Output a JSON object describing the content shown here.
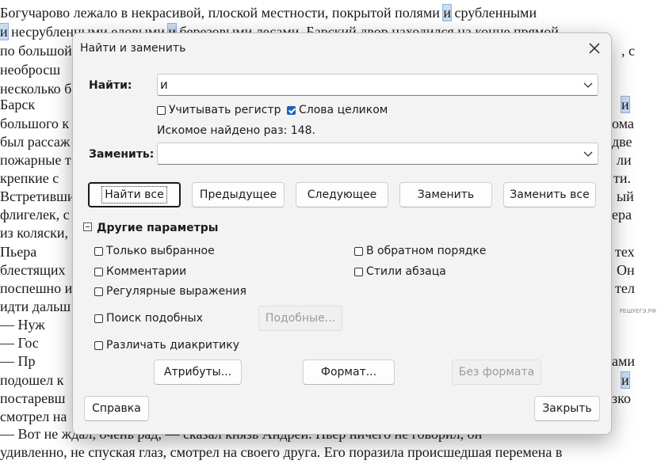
{
  "document": {
    "lines": [
      {
        "text": "        Богучарово лежало в некрасивой, плоской местности, покрытой полями ",
        "hl": "и",
        "tail": " срубленными"
      },
      {
        "text": "",
        "hl": "и",
        "tail": " несрубленными еловыми и березовыми лесами. Барский двор находился на конце прямой,"
      },
      {
        "text": "по большой",
        "hl": "",
        "tail": "                                                                                                   , с"
      },
      {
        "text": "необросш",
        "hl": "",
        "tail": ""
      },
      {
        "text": "несколько б",
        "hl": "",
        "tail": ""
      },
      {
        "text": "        Барск",
        "hl": "",
        "tail": ""
      },
      {
        "text": "большого к",
        "hl": "",
        "tail": ""
      },
      {
        "text": "был рассаж",
        "hl": "",
        "tail": ""
      },
      {
        "text": "пожарные т",
        "hl": "",
        "tail": ""
      },
      {
        "text": "крепкие  с",
        "hl": "",
        "tail": ""
      },
      {
        "text": "Встретивши",
        "hl": "",
        "tail": ""
      },
      {
        "text": "флигелек, с",
        "hl": "",
        "tail": ""
      },
      {
        "text": "из коляски,",
        "hl": "",
        "tail": ""
      },
      {
        "text": "        Пьера",
        "hl": "",
        "tail": ""
      },
      {
        "text": "блестящих",
        "hl": "",
        "tail": ""
      },
      {
        "text": "поспешно и",
        "hl": "",
        "tail": ""
      },
      {
        "text": "идти дальш",
        "hl": "",
        "tail": ""
      },
      {
        "text": "        — Нуж",
        "hl": "",
        "tail": ""
      },
      {
        "text": "        — Гос",
        "hl": "",
        "tail": ""
      },
      {
        "text": "        — Пр",
        "hl": "",
        "tail": ""
      },
      {
        "text": "подошел к",
        "hl": "",
        "tail": ""
      },
      {
        "text": "постаревш",
        "hl": "",
        "tail": ""
      },
      {
        "text": "смотрел на",
        "hl": "",
        "tail": ""
      },
      {
        "text": "        — Вот не ждал, очень рад, — сказал князь Андрей. Пьер ничего не говорил, он",
        "hl": "",
        "tail": ""
      },
      {
        "text": "удивленно, не спуская глаз, смотрел на своего друга. Его поразила происшедшая перемена в",
        "hl": "",
        "tail": ""
      }
    ],
    "right_fragments": [
      "тех",
      "Он",
      "тел",
      "ами",
      "и",
      "зко",
      "ома",
      "две",
      "ли",
      "ти.",
      "ый",
      "ера"
    ],
    "watermark": "РЕШУЕГЭ.РФ"
  },
  "dialog": {
    "title": "Найти и заменить",
    "find_label": "Найти:",
    "find_value": "и",
    "match_case_label": "Учитывать регистр",
    "match_case_checked": false,
    "whole_words_label": "Слова целиком",
    "whole_words_checked": true,
    "status": "Искомое найдено раз: 148.",
    "replace_label": "Заменить:",
    "replace_value": "",
    "buttons": {
      "find_all": "Найти все",
      "previous": "Предыдущее",
      "next": "Следующее",
      "replace": "Заменить",
      "replace_all": "Заменить все"
    },
    "other_options_label": "Другие параметры",
    "options": {
      "current_selection": "Только выбранное",
      "backwards": "В обратном порядке",
      "comments": "Комментарии",
      "paragraph_styles": "Стили абзаца",
      "regex": "Регулярные выражения",
      "similarity": "Поиск подобных",
      "similarity_button": "Подобные...",
      "diacritics": "Различать диакритику"
    },
    "attributes_button": "Атрибуты...",
    "format_button": "Формат...",
    "no_format_button": "Без формата",
    "help_button": "Справка",
    "close_button": "Закрыть"
  },
  "colors": {
    "accent": "#1f5fbf",
    "highlight": "#c9dcf2"
  }
}
